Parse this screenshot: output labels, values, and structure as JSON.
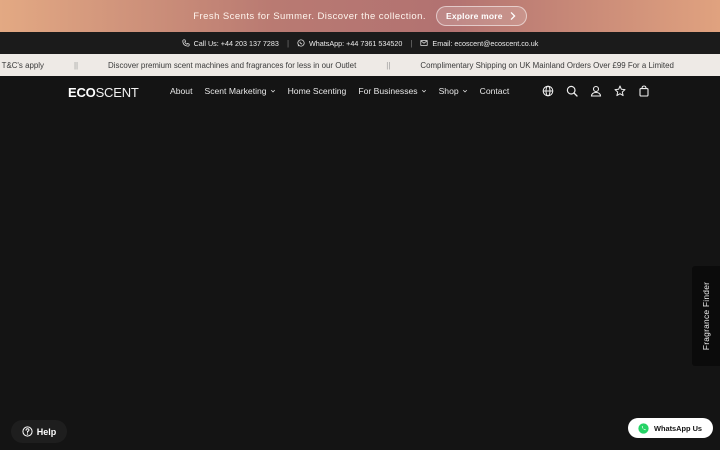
{
  "promo": {
    "text": "Fresh Scents for Summer. Discover the collection.",
    "button_label": "Explore more"
  },
  "contact": {
    "call": "Call Us: +44 203 137 7283",
    "whatsapp": "WhatsApp: +44 7361 534520",
    "email": "Email: ecoscent@ecoscent.co.uk",
    "separator": "|"
  },
  "ticker": {
    "items": [
      "ee - T&C's apply",
      "Discover premium scent machines and fragrances for less in our Outlet",
      "Complimentary Shipping on UK Mainland Orders Over £99 For a Limited"
    ],
    "separator": "||"
  },
  "header": {
    "logo_bold": "ECO",
    "logo_light": "SCENT",
    "nav": [
      {
        "label": "About",
        "dropdown": false
      },
      {
        "label": "Scent Marketing",
        "dropdown": true
      },
      {
        "label": "Home Scenting",
        "dropdown": false
      },
      {
        "label": "For Businesses",
        "dropdown": true
      },
      {
        "label": "Shop",
        "dropdown": true
      },
      {
        "label": "Contact",
        "dropdown": false
      }
    ],
    "icons": [
      "globe-icon",
      "search-icon",
      "account-icon",
      "wishlist-star-icon",
      "bag-icon"
    ]
  },
  "fragrance_finder": {
    "label": "Fragrance Finder"
  },
  "help": {
    "label": "Help"
  },
  "whatsapp_button": {
    "label": "WhatsApp Us",
    "color": "#25d366"
  },
  "colors": {
    "background": "#141414",
    "promo_start": "#e3a983",
    "promo_mid": "#b27271",
    "ticker_bg": "#eeeae6"
  }
}
